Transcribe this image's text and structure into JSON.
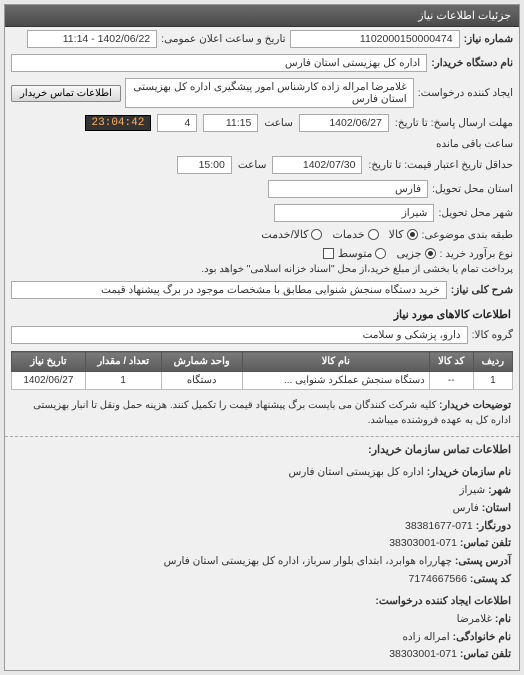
{
  "panel": {
    "title": "جزئیات اطلاعات نیاز"
  },
  "header": {
    "req_number_label": "شماره نیاز:",
    "req_number": "1102000150000474",
    "public_notice_label": "تاریخ و ساعت اعلان عمومی:",
    "public_notice": "1402/06/22 - 11:14",
    "requester_label": "نام دستگاه خریدار:",
    "requester": "اداره کل بهزیستی استان فارس",
    "creator_label": "ایجاد کننده درخواست:",
    "creator": "غلامرضا امراله زاده کارشناس امور پیشگیری اداره کل بهزیستی استان فارس",
    "contact_btn": "اطلاعات تماس خریدار",
    "deadline_to_label": "مهلت ارسال پاسخ: تا تاریخ:",
    "deadline_to_date": "1402/06/27",
    "time_label": "ساعت",
    "deadline_to_time": "11:15",
    "days_val": "4",
    "countdown": "23:04:42",
    "remaining_label": "ساعت باقی مانده",
    "validity_to_label": "حداقل تاریخ اعتبار قیمت: تا تاریخ:",
    "validity_to_date": "1402/07/30",
    "validity_to_time": "15:00",
    "province_label": "استان محل تحویل:",
    "province": "فارس",
    "city_label": "شهر محل تحویل:",
    "city": "شیراز",
    "priority_label": "طبقه بندی موضوعی:",
    "priority_opts": {
      "kala": "کالا",
      "khadamat": "خدمات",
      "kalakhadamat": "کالا/خدمت"
    },
    "purchase_type_label": "نوع برآورد خرید :",
    "purchase_opts": {
      "motavaset": "متوسط",
      "jozi": "جزیی"
    },
    "purchase_note": "پرداخت تمام یا بخشی از مبلغ خرید،از محل \"اسناد خزانه اسلامی\" خواهد بود.",
    "desc_label": "شرح کلی نیاز:",
    "desc": "خرید دستگاه سنجش شنوایی مطابق با مشخصات موجود در برگ پیشنهاد قیمت"
  },
  "goods": {
    "section_title": "اطلاعات کالاهای مورد نیاز",
    "group_label": "گروه کالا:",
    "group": "دارو، پزشکی و سلامت",
    "columns": [
      "ردیف",
      "کد کالا",
      "نام کالا",
      "واحد شمارش",
      "تعداد / مقدار",
      "تاریخ نیاز"
    ],
    "rows": [
      {
        "row": "1",
        "code": "--",
        "name": "دستگاه سنجش عملکرد شنوایی ...",
        "unit": "دستگاه",
        "qty": "1",
        "date": "1402/06/27"
      }
    ],
    "note_label": "توضیحات خریدار:",
    "note": "کلیه شرکت کنندگان می بایست برگ پیشنهاد قیمت را تکمیل کنند. هزینه حمل ونقل تا انبار بهزیستی اداره کل به عهده فروشنده میباشد."
  },
  "contact": {
    "section_title": "اطلاعات تماس سازمان خریدار:",
    "org_label": "نام سازمان خریدار:",
    "org": "اداره کل بهزیستی استان فارس",
    "city_label": "شهر:",
    "city": "شیراز",
    "prov_label": "استان:",
    "prov": "فارس",
    "fax_label": "دورنگار:",
    "fax": "071-38381677",
    "phone_label": "تلفن تماس:",
    "phone": "071-38303001",
    "addr_label": "آدرس پستی:",
    "addr": "چهارراه هوابرد، ابتدای بلوار سرباز، اداره کل بهزیستی استان فارس",
    "zip_label": "کد پستی:",
    "zip": "7174667566",
    "creator_section_title": "اطلاعات ایجاد کننده درخواست:",
    "fname_label": "نام:",
    "fname": "غلامرضا",
    "lname_label": "نام خانوادگی:",
    "lname": "امراله زاده",
    "cphone_label": "تلفن تماس:",
    "cphone": "071-38303001"
  }
}
